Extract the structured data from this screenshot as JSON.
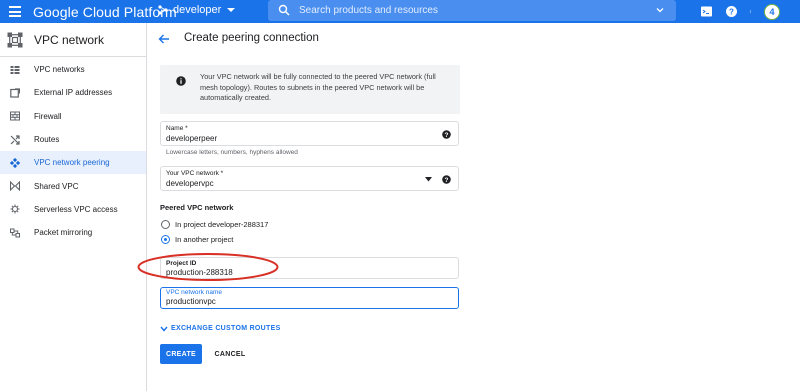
{
  "topbar": {
    "brand": "Google Cloud Platform",
    "project_name": "developer",
    "search_placeholder": "Search products and resources",
    "avatar_label": "4",
    "accent_color": "#1a73e8"
  },
  "sidebar": {
    "title": "VPC network",
    "items": [
      {
        "label": "VPC networks",
        "icon": "vpc-networks-icon",
        "active": false
      },
      {
        "label": "External IP addresses",
        "icon": "external-ip-icon",
        "active": false
      },
      {
        "label": "Firewall",
        "icon": "firewall-icon",
        "active": false
      },
      {
        "label": "Routes",
        "icon": "routes-icon",
        "active": false
      },
      {
        "label": "VPC network peering",
        "icon": "peering-icon",
        "active": true
      },
      {
        "label": "Shared VPC",
        "icon": "shared-vpc-icon",
        "active": false
      },
      {
        "label": "Serverless VPC access",
        "icon": "serverless-icon",
        "active": false
      },
      {
        "label": "Packet mirroring",
        "icon": "packet-mirroring-icon",
        "active": false
      }
    ]
  },
  "main": {
    "title": "Create peering connection",
    "info_text": "Your VPC network will be fully connected to the peered VPC network (full mesh topology). Routes to subnets in the peered VPC network will be automatically created.",
    "name_field": {
      "label": "Name *",
      "value": "developerpeer",
      "hint": "Lowercase letters, numbers, hyphens allowed"
    },
    "vpc_field": {
      "label": "Your VPC network *",
      "value": "developervpc"
    },
    "peered_section_title": "Peered VPC network",
    "radio_options": [
      {
        "label": "In project developer-288317",
        "selected": false
      },
      {
        "label": "In another project",
        "selected": true
      }
    ],
    "project_id_field": {
      "label": "Project ID",
      "value": "production-288318"
    },
    "vpc_name_field": {
      "label": "VPC network name",
      "value": "productionvpc"
    },
    "exchange_link": "EXCHANGE CUSTOM ROUTES",
    "create_label": "CREATE",
    "cancel_label": "CANCEL",
    "annotation_color": "#d93025"
  }
}
